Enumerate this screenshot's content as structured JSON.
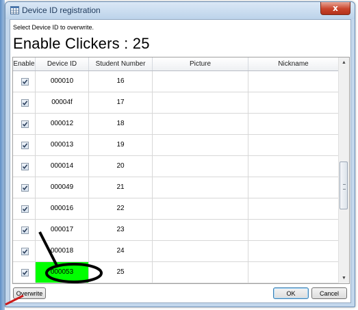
{
  "window": {
    "title": "Device ID registration",
    "close_label": "x"
  },
  "instruction": "Select Device ID to overwrite.",
  "heading": "Enable Clickers : 25",
  "table": {
    "columns": [
      "Enable",
      "Device ID",
      "Student Number",
      "Picture",
      "Nickname"
    ],
    "rows": [
      {
        "enabled": true,
        "device_id": "000010",
        "student_number": "16",
        "picture": "",
        "nickname": ""
      },
      {
        "enabled": true,
        "device_id": "00004f",
        "student_number": "17",
        "picture": "",
        "nickname": ""
      },
      {
        "enabled": true,
        "device_id": "000012",
        "student_number": "18",
        "picture": "",
        "nickname": ""
      },
      {
        "enabled": true,
        "device_id": "000013",
        "student_number": "19",
        "picture": "",
        "nickname": ""
      },
      {
        "enabled": true,
        "device_id": "000014",
        "student_number": "20",
        "picture": "",
        "nickname": ""
      },
      {
        "enabled": true,
        "device_id": "000049",
        "student_number": "21",
        "picture": "",
        "nickname": ""
      },
      {
        "enabled": true,
        "device_id": "000016",
        "student_number": "22",
        "picture": "",
        "nickname": ""
      },
      {
        "enabled": true,
        "device_id": "000017",
        "student_number": "23",
        "picture": "",
        "nickname": ""
      },
      {
        "enabled": true,
        "device_id": "000018",
        "student_number": "24",
        "picture": "",
        "nickname": ""
      },
      {
        "enabled": true,
        "device_id": "000053",
        "student_number": "25",
        "picture": "",
        "nickname": "",
        "highlighted": true
      }
    ]
  },
  "buttons": {
    "overwrite": "Overwrite",
    "ok": "OK",
    "cancel": "Cancel"
  },
  "colors": {
    "highlight": "#00ff00",
    "annotation_circle": "#000000",
    "annotation_arrow": "#cc0000"
  }
}
